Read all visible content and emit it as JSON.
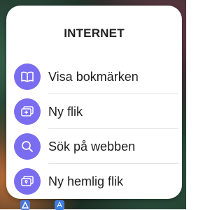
{
  "dialog": {
    "title": "INTERNET",
    "items": [
      {
        "label": "Visa bokmärken",
        "icon": "bookmarks-icon"
      },
      {
        "label": "Ny flik",
        "icon": "new-tab-icon"
      },
      {
        "label": "Sök på webben",
        "icon": "search-icon"
      },
      {
        "label": "Ny hemlig flik",
        "icon": "secret-tab-icon"
      }
    ]
  },
  "dock": {
    "right_icon_glyph": "A"
  },
  "colors": {
    "icon_circle": "#7a6df0",
    "text": "#1f1f1f",
    "divider": "#e3e3e3"
  }
}
